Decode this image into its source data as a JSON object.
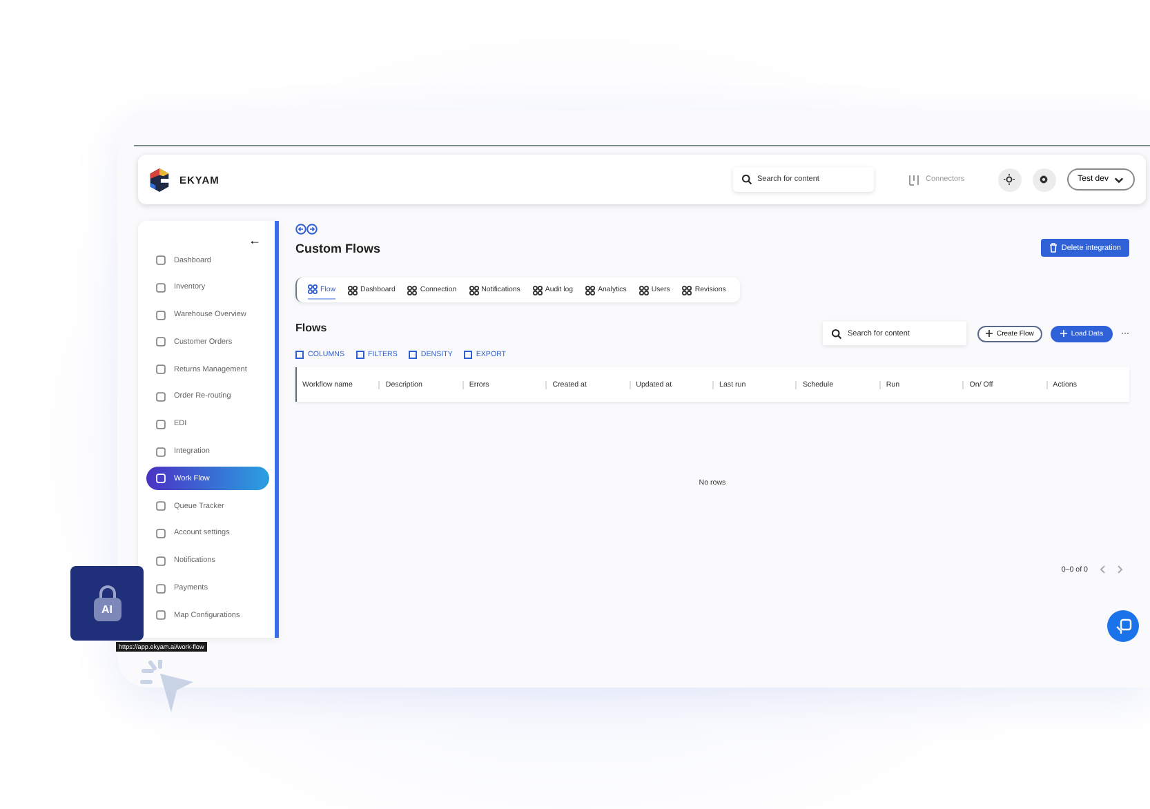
{
  "header": {
    "brand": "EKYAM",
    "search": {
      "placeholder": "Search for content"
    },
    "connectors": "Connectors",
    "user": "Test dev"
  },
  "sidebar": {
    "collapse": "←",
    "items": [
      {
        "label": "Dashboard",
        "selected": false
      },
      {
        "label": "Inventory",
        "selected": false
      },
      {
        "label": "Warehouse Overview",
        "selected": false
      },
      {
        "label": "Customer Orders",
        "selected": false
      },
      {
        "label": "Returns Management",
        "selected": false
      },
      {
        "label": "Order Re-routing",
        "selected": false
      },
      {
        "label": "EDI",
        "selected": false
      },
      {
        "label": "Integration",
        "selected": false
      },
      {
        "label": "Work Flow",
        "selected": true
      },
      {
        "label": "Queue Tracker",
        "selected": false
      },
      {
        "label": "Account settings",
        "selected": false
      },
      {
        "label": "Notifications",
        "selected": false
      },
      {
        "label": "Payments",
        "selected": false
      },
      {
        "label": "Map Configurations",
        "selected": false
      }
    ]
  },
  "page": {
    "title": "Custom Flows",
    "delete_button": "Delete integration"
  },
  "tabs": [
    {
      "label": "Flow",
      "selected": true
    },
    {
      "label": "Dashboard",
      "selected": false
    },
    {
      "label": "Connection",
      "selected": false
    },
    {
      "label": "Notifications",
      "selected": false
    },
    {
      "label": "Audit log",
      "selected": false
    },
    {
      "label": "Analytics",
      "selected": false
    },
    {
      "label": "Users",
      "selected": false
    },
    {
      "label": "Revisions",
      "selected": false
    }
  ],
  "flows": {
    "title": "Flows",
    "search": {
      "placeholder": "Search for content"
    },
    "create_button": "Create Flow",
    "load_button": "Load Data",
    "more": "···",
    "toolbar": [
      "COLUMNS",
      "FILTERS",
      "DENSITY",
      "EXPORT"
    ],
    "table": {
      "columns": [
        "Workflow name",
        "Description",
        "Errors",
        "Created at",
        "Updated at",
        "Last run",
        "Schedule",
        "Run",
        "On/ Off",
        "Actions"
      ],
      "empty": "No rows"
    },
    "pagination": "0–0 of 0"
  },
  "ai_badge": "AI",
  "link_tooltip": "https://app.ekyam.ai/work-flow"
}
